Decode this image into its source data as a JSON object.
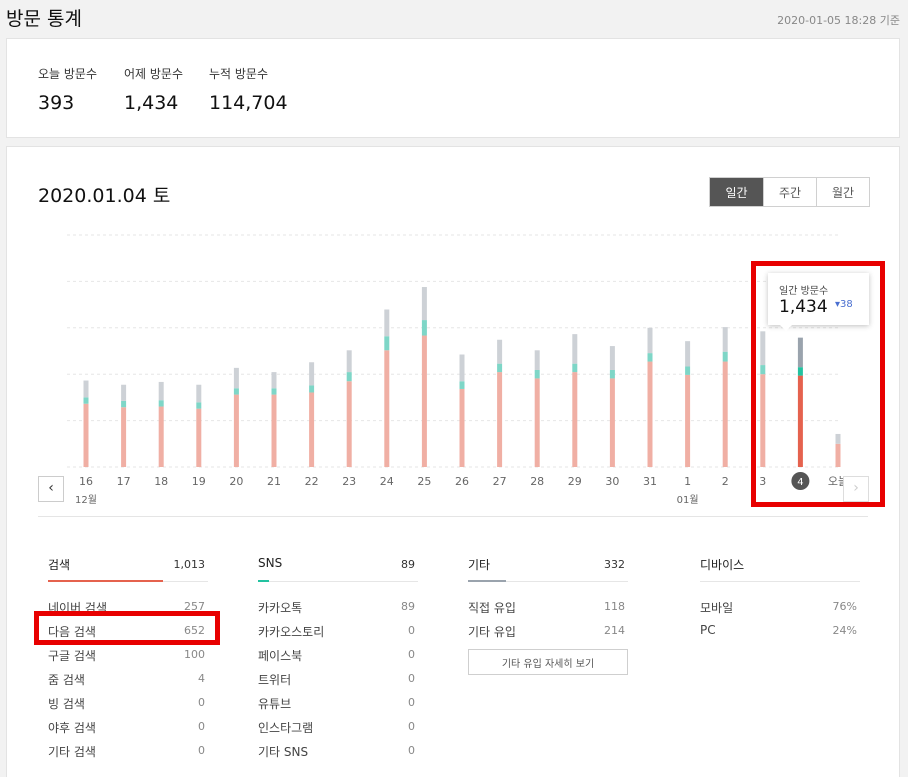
{
  "header": {
    "title": "방문 통계",
    "timestamp": "2020-01-05 18:28 기준"
  },
  "summary": [
    {
      "label": "오늘 방문수",
      "value": "393"
    },
    {
      "label": "어제 방문수",
      "value": "1,434"
    },
    {
      "label": "누적 방문수",
      "value": "114,704"
    }
  ],
  "main": {
    "date_title": "2020.01.04 토",
    "period_tabs": [
      "일간",
      "주간",
      "월간"
    ],
    "active_tab": "일간",
    "prev_label": "‹",
    "next_label": "›"
  },
  "tooltip": {
    "label": "일간 방문수",
    "value": "1,434",
    "delta": "▾38"
  },
  "colors": {
    "search": "#f0afa4",
    "search_active": "#e5624e",
    "sns": "#7ed6c7",
    "sns_active": "#23c2a0",
    "other": "#cdd1d6",
    "other_active": "#9aa3ad",
    "highlight": "#e80000",
    "search_bar": "#e5624e",
    "sns_bar": "#23c2a0",
    "other_bar": "#9aa3ad"
  },
  "chart_data": {
    "type": "bar",
    "stacked": true,
    "categories": [
      "16",
      "17",
      "18",
      "19",
      "20",
      "21",
      "22",
      "23",
      "24",
      "25",
      "26",
      "27",
      "28",
      "29",
      "30",
      "31",
      "1",
      "2",
      "3",
      "4",
      "오늘"
    ],
    "series": [
      {
        "key": "search",
        "values": [
          900,
          850,
          860,
          830,
          1030,
          1030,
          1060,
          1220,
          1660,
          1870,
          1110,
          1350,
          1260,
          1350,
          1260,
          1500,
          1310,
          1500,
          1320,
          1300,
          330
        ]
      },
      {
        "key": "sns",
        "values": [
          90,
          90,
          90,
          90,
          90,
          90,
          100,
          130,
          200,
          220,
          110,
          120,
          120,
          120,
          120,
          120,
          120,
          140,
          130,
          120,
          0
        ]
      },
      {
        "key": "other",
        "values": [
          240,
          230,
          260,
          250,
          290,
          230,
          330,
          310,
          380,
          470,
          380,
          340,
          280,
          420,
          340,
          360,
          360,
          350,
          480,
          420,
          140
        ]
      }
    ],
    "x_sublabels": [
      {
        "index": 0,
        "text": "12월"
      },
      {
        "index": 16,
        "text": "01월"
      }
    ],
    "selected_index": 19,
    "ylim": [
      0,
      3300
    ],
    "grid": true,
    "legend": "none"
  },
  "stats": {
    "search": {
      "title": "검색",
      "total": "1,013",
      "ratio": 0.72,
      "items": [
        {
          "label": "네이버 검색",
          "value": "257"
        },
        {
          "label": "다음 검색",
          "value": "652"
        },
        {
          "label": "구글 검색",
          "value": "100"
        },
        {
          "label": "줌 검색",
          "value": "4"
        },
        {
          "label": "빙 검색",
          "value": "0"
        },
        {
          "label": "야후 검색",
          "value": "0"
        },
        {
          "label": "기타 검색",
          "value": "0"
        }
      ]
    },
    "sns": {
      "title": "SNS",
      "total": "89",
      "ratio": 0.07,
      "items": [
        {
          "label": "카카오톡",
          "value": "89"
        },
        {
          "label": "카카오스토리",
          "value": "0"
        },
        {
          "label": "페이스북",
          "value": "0"
        },
        {
          "label": "트위터",
          "value": "0"
        },
        {
          "label": "유튜브",
          "value": "0"
        },
        {
          "label": "인스타그램",
          "value": "0"
        },
        {
          "label": "기타 SNS",
          "value": "0"
        }
      ]
    },
    "other": {
      "title": "기타",
      "total": "332",
      "ratio": 0.24,
      "items": [
        {
          "label": "직접 유입",
          "value": "118"
        },
        {
          "label": "기타 유입",
          "value": "214"
        }
      ],
      "detail_button": "기타 유입 자세히 보기"
    },
    "device": {
      "title": "디바이스",
      "items": [
        {
          "label": "모바일",
          "value": "76%"
        },
        {
          "label": "PC",
          "value": "24%"
        }
      ]
    }
  }
}
